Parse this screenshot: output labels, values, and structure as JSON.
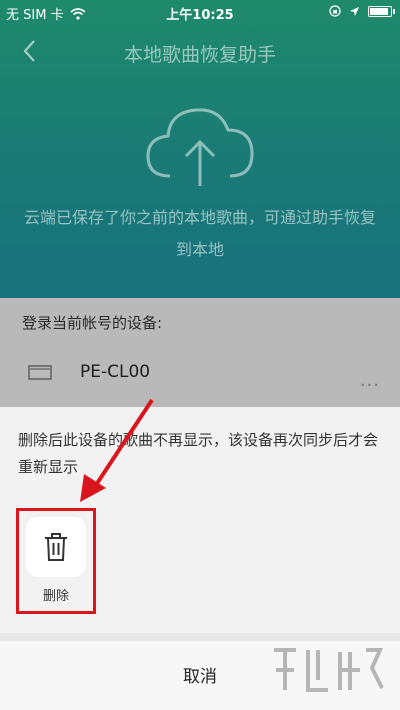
{
  "status_bar": {
    "carrier": "无 SIM 卡",
    "time": "上午10:25"
  },
  "nav": {
    "title": "本地歌曲恢复助手"
  },
  "intro": {
    "text": "云端已保存了你之前的本地歌曲，可通过助手恢复到本地"
  },
  "device_panel": {
    "title": "登录当前帐号的设备:",
    "devices": [
      {
        "name": "PE-CL00",
        "more": "..."
      }
    ]
  },
  "action_sheet": {
    "description": "删除后此设备的歌曲不再显示，该设备再次同步后才会重新显示",
    "actions": [
      {
        "label": "删除",
        "icon": "trash-icon"
      }
    ],
    "cancel_label": "取消"
  },
  "colors": {
    "header_green": "#1e8a6a",
    "highlight_red": "#d8161b",
    "sheet_bg": "#f2f2f2"
  }
}
